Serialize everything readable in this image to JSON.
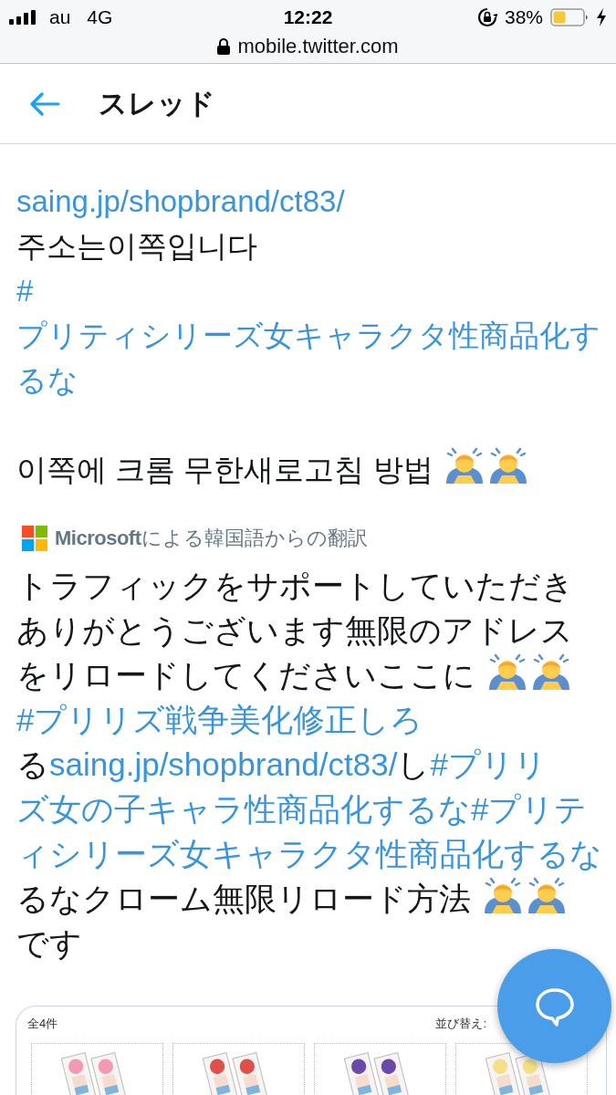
{
  "status_bar": {
    "carrier": "au",
    "network": "4G",
    "time": "12:22",
    "battery": "38%"
  },
  "address_bar": {
    "url": "mobile.twitter.com"
  },
  "header": {
    "title": "スレッド"
  },
  "tweet": {
    "segments": [
      {
        "kind": "url",
        "text": "saing.jp/shopbrand/ct83/"
      },
      {
        "kind": "newline"
      },
      {
        "kind": "text",
        "text": "주소는이쪽입니다"
      },
      {
        "kind": "newline"
      },
      {
        "kind": "hashtag",
        "text": "#"
      },
      {
        "kind": "hashtag",
        "text": "プリティシリーズ女キャラクタ性商品化す"
      },
      {
        "kind": "hashtag",
        "text": "るな"
      },
      {
        "kind": "newline"
      },
      {
        "kind": "newline"
      },
      {
        "kind": "text",
        "text": "이쪽에 크롬 무한새로고침 방법 "
      },
      {
        "kind": "emoji"
      },
      {
        "kind": "emoji"
      }
    ]
  },
  "translation": {
    "label": "**Microsoft**による韓国語からの翻訳",
    "segments": [
      {
        "kind": "text",
        "text": "トラフィックをサポートしていただき"
      },
      {
        "kind": "text",
        "text": "ありがとうございます無限のアドレス"
      },
      {
        "kind": "text",
        "text": "をリロードしてくださいここに "
      },
      {
        "kind": "emoji"
      },
      {
        "kind": "emoji"
      },
      {
        "kind": "hashtag",
        "text": "#プリリズ戦争美化修正しろ"
      },
      {
        "kind": "newline"
      },
      {
        "kind": "text",
        "text": "る"
      },
      {
        "kind": "url",
        "text": "saing.jp/shopbrand/ct83/"
      },
      {
        "kind": "text",
        "text": "し"
      },
      {
        "kind": "hashtag",
        "text": "#プリリ"
      },
      {
        "kind": "hashtag",
        "text": "ズ女の子キャラ性商品化するな"
      },
      {
        "kind": "hashtag",
        "text": "#プリテ"
      },
      {
        "kind": "hashtag",
        "text": "ィシリーズ女キャラクタ性商品化するな"
      },
      {
        "kind": "text",
        "text": "るなクローム無限リロード方法 "
      },
      {
        "kind": "emoji"
      },
      {
        "kind": "emoji"
      },
      {
        "kind": "text",
        "text": "です"
      }
    ]
  },
  "attached_image": {
    "count": "全4件",
    "sort_label": "並び替え:"
  }
}
